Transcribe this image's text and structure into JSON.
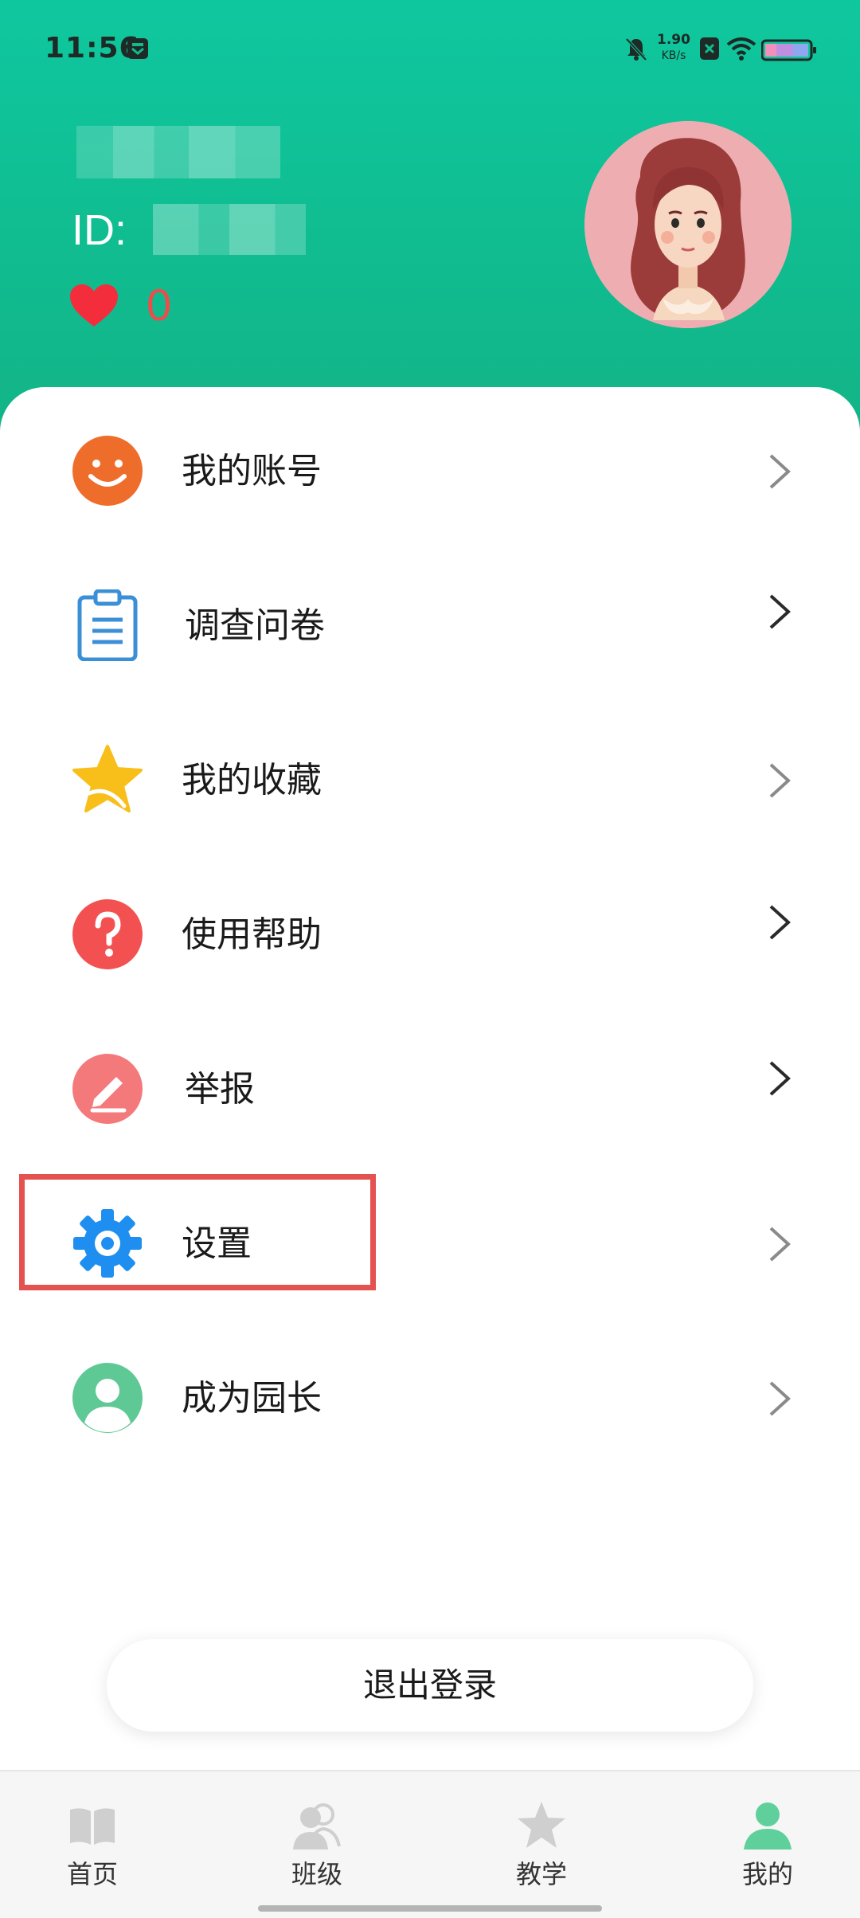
{
  "status_bar": {
    "time": "11:56",
    "net_speed_value": "1.90",
    "net_speed_unit": "KB/s"
  },
  "profile": {
    "id_label": "ID:",
    "likes_count": "0"
  },
  "menu": {
    "items": [
      {
        "label": "我的账号",
        "icon": "smiley-icon",
        "color": "#ef6d2b"
      },
      {
        "label": "调查问卷",
        "icon": "clipboard-icon",
        "color": "#3b8fd6"
      },
      {
        "label": "我的收藏",
        "icon": "star-icon",
        "color": "#f8bf1b"
      },
      {
        "label": "使用帮助",
        "icon": "question-icon",
        "color": "#f35151"
      },
      {
        "label": "举报",
        "icon": "pencil-icon",
        "color": "#f4797b"
      },
      {
        "label": "设置",
        "icon": "gear-icon",
        "color": "#1e8ff0"
      },
      {
        "label": "成为园长",
        "icon": "person-icon",
        "color": "#5ec995"
      }
    ]
  },
  "logout_label": "退出登录",
  "nav": {
    "items": [
      {
        "label": "首页",
        "icon": "book-icon"
      },
      {
        "label": "班级",
        "icon": "people-icon"
      },
      {
        "label": "教学",
        "icon": "star-icon"
      },
      {
        "label": "我的",
        "icon": "person-icon",
        "active": true
      }
    ],
    "active_color": "#5fcf9b",
    "inactive_color": "#cfcfcf"
  },
  "colors": {
    "header": "#10bd91",
    "highlight": "#e4534f"
  }
}
